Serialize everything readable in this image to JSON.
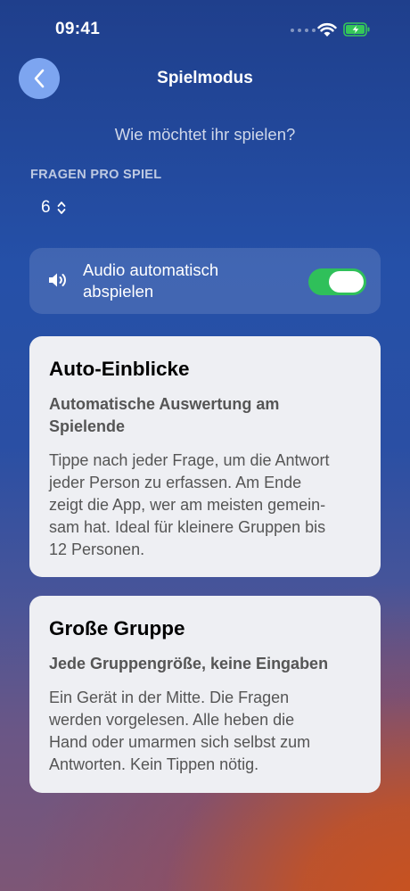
{
  "status_bar": {
    "time": "09:41"
  },
  "nav": {
    "title": "Spielmodus"
  },
  "subtitle": "Wie möchtet ihr spielen?",
  "questions": {
    "section_label": "FRAGEN PRO SPIEL",
    "value": "6"
  },
  "audio": {
    "label_line1": "Audio automatisch",
    "label_line2": "abspielen",
    "enabled": true
  },
  "modes": [
    {
      "title": "Auto-Einblicke",
      "subtitle_lines": [
        "Automatische Auswertung am",
        "Spielende"
      ],
      "body_lines": [
        "Tippe nach jeder Frage, um die Antwort",
        "jeder Person zu erfassen. Am Ende",
        "zeigt die App, wer am meisten gemein-",
        "sam hat. Ideal für kleinere Gruppen bis",
        "12 Personen."
      ]
    },
    {
      "title": "Große Gruppe",
      "subtitle_lines": [
        "Jede Gruppengröße, keine Eingaben"
      ],
      "body_lines": [
        "Ein Gerät in der Mitte. Die Fragen",
        "werden vorgelesen. Alle heben die",
        "Hand oder umarmen sich selbst zum",
        "Antworten. Kein Tippen nötig."
      ]
    }
  ],
  "colors": {
    "toggle_on": "#2fc05a",
    "back_button": "#7da5f0",
    "card_bg": "#eeeff3",
    "battery": "#34c759"
  }
}
